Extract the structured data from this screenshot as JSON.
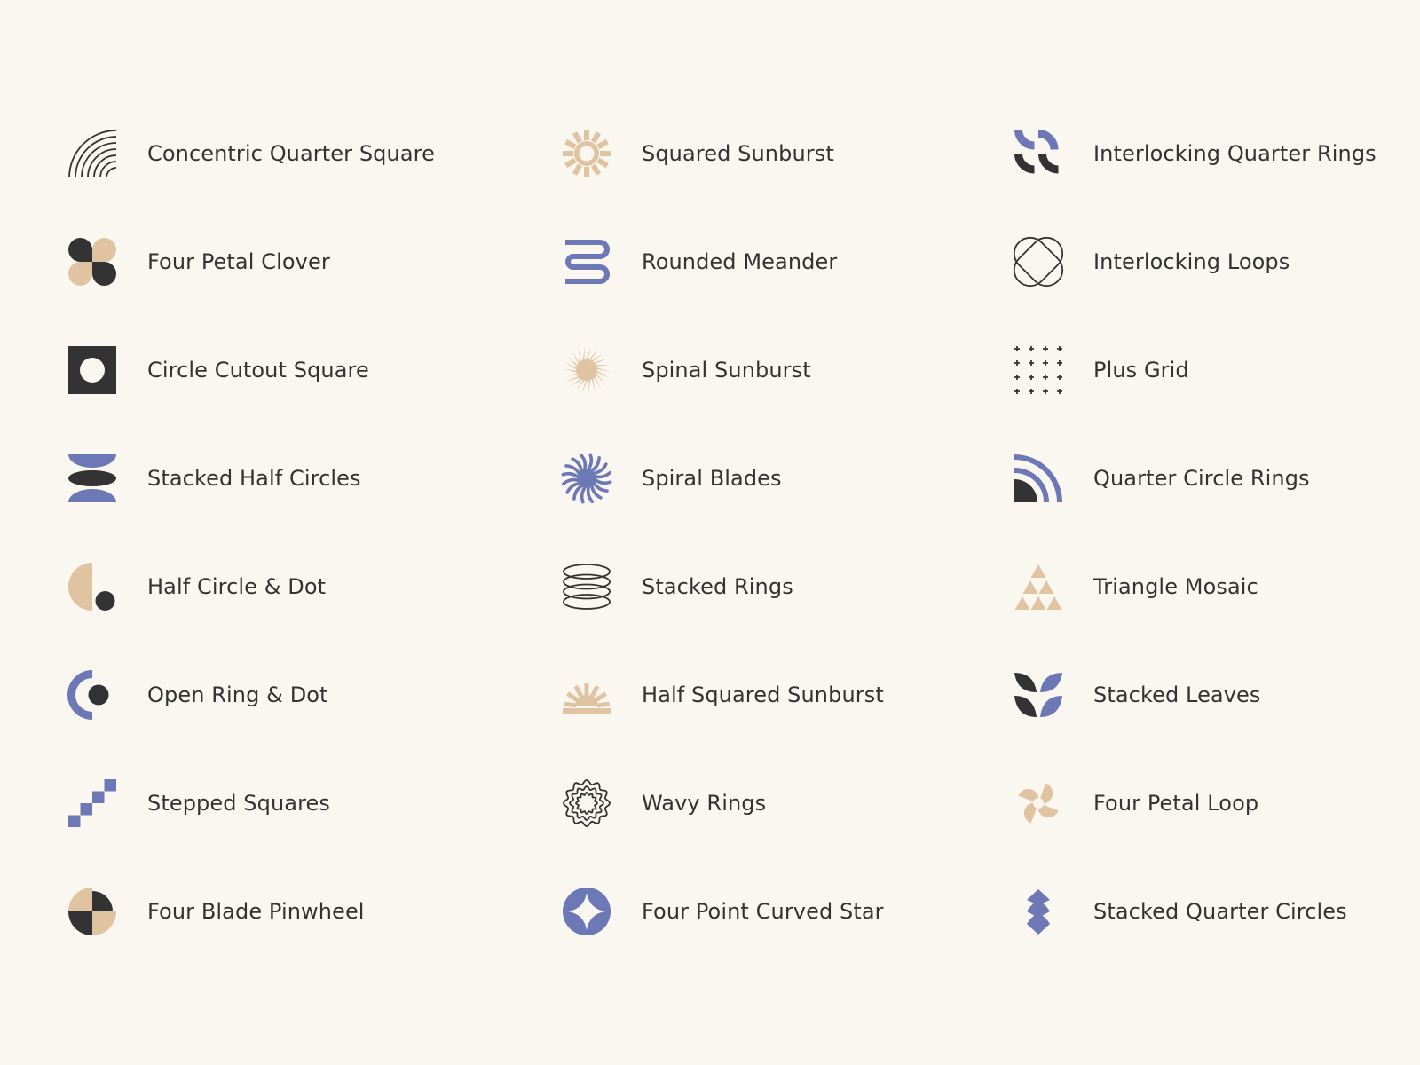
{
  "colors": {
    "background": "#faf7f1",
    "dark": "#333333",
    "tan": "#e0c4a2",
    "blue": "#6d78b6"
  },
  "items": [
    {
      "label": "Concentric Quarter Square",
      "icon": "concentric-quarter-square-icon"
    },
    {
      "label": "Four Petal Clover",
      "icon": "four-petal-clover-icon"
    },
    {
      "label": "Circle Cutout Square",
      "icon": "circle-cutout-square-icon"
    },
    {
      "label": "Stacked Half Circles",
      "icon": "stacked-half-circles-icon"
    },
    {
      "label": "Half Circle & Dot",
      "icon": "half-circle-dot-icon"
    },
    {
      "label": "Open Ring & Dot",
      "icon": "open-ring-dot-icon"
    },
    {
      "label": "Stepped Squares",
      "icon": "stepped-squares-icon"
    },
    {
      "label": "Four Blade Pinwheel",
      "icon": "four-blade-pinwheel-icon"
    },
    {
      "label": "Squared Sunburst",
      "icon": "squared-sunburst-icon"
    },
    {
      "label": "Rounded Meander",
      "icon": "rounded-meander-icon"
    },
    {
      "label": "Spinal Sunburst",
      "icon": "spinal-sunburst-icon"
    },
    {
      "label": "Spiral Blades",
      "icon": "spiral-blades-icon"
    },
    {
      "label": "Stacked Rings",
      "icon": "stacked-rings-icon"
    },
    {
      "label": "Half Squared Sunburst",
      "icon": "half-squared-sunburst-icon"
    },
    {
      "label": "Wavy Rings",
      "icon": "wavy-rings-icon"
    },
    {
      "label": "Four Point Curved Star",
      "icon": "four-point-curved-star-icon"
    },
    {
      "label": "Interlocking Quarter Rings",
      "icon": "interlocking-quarter-rings-icon"
    },
    {
      "label": "Interlocking Loops",
      "icon": "interlocking-loops-icon"
    },
    {
      "label": "Plus Grid",
      "icon": "plus-grid-icon"
    },
    {
      "label": "Quarter Circle Rings",
      "icon": "quarter-circle-rings-icon"
    },
    {
      "label": "Triangle Mosaic",
      "icon": "triangle-mosaic-icon"
    },
    {
      "label": "Stacked Leaves",
      "icon": "stacked-leaves-icon"
    },
    {
      "label": "Four Petal Loop",
      "icon": "four-petal-loop-icon"
    },
    {
      "label": "Stacked Quarter Circles",
      "icon": "stacked-quarter-circles-icon"
    }
  ]
}
